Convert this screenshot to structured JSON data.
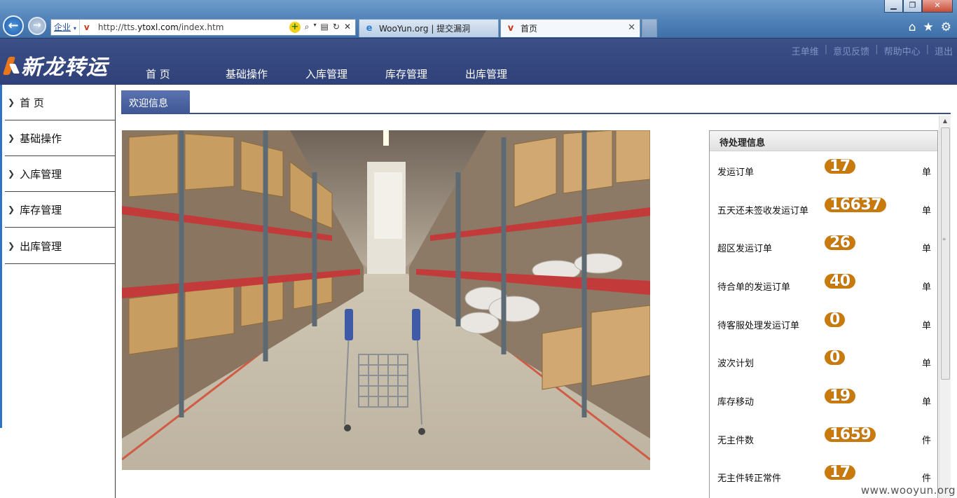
{
  "browser": {
    "window_controls": {
      "minimize": "▁",
      "maximize": "❐",
      "close": "✕"
    },
    "address": {
      "zone": "企业",
      "url_prefix": "http://tts.",
      "url_domain": "ytoxl.com",
      "url_path": "/index.htm"
    },
    "tabs": [
      {
        "label": "WooYun.org | 提交漏洞"
      },
      {
        "label": "首页"
      }
    ],
    "tab_close": "✕"
  },
  "header": {
    "logo_text": "新龙转运",
    "links": [
      "王单维",
      "意见反馈",
      "帮助中心",
      "退出"
    ],
    "separator": "|",
    "nav": [
      "首 页",
      "基础操作",
      "入库管理",
      "库存管理",
      "出库管理"
    ]
  },
  "sidebar": {
    "items": [
      "首 页",
      "基础操作",
      "入库管理",
      "库存管理",
      "出库管理"
    ]
  },
  "content": {
    "welcome_tab": "欢迎信息"
  },
  "pending": {
    "title": "待处理信息",
    "rows": [
      {
        "label": "发运订单",
        "count": "17",
        "unit": "单"
      },
      {
        "label": "五天还未签收发运订单",
        "count": "16637",
        "unit": "单"
      },
      {
        "label": "超区发运订单",
        "count": "26",
        "unit": "单"
      },
      {
        "label": "待合单的发运订单",
        "count": "40",
        "unit": "单"
      },
      {
        "label": "待客服处理发运订单",
        "count": "0",
        "unit": "单"
      },
      {
        "label": "波次计划",
        "count": "0",
        "unit": "单"
      },
      {
        "label": "库存移动",
        "count": "19",
        "unit": "单"
      },
      {
        "label": "无主件数",
        "count": "1659",
        "unit": "件"
      },
      {
        "label": "无主件转正常件",
        "count": "17",
        "unit": "件"
      }
    ]
  },
  "watermark": "www.wooyun.org",
  "colors": {
    "header_bg": "#34467e",
    "badge": "#c87a0c",
    "sidebar_edge": "#2f73c7"
  }
}
